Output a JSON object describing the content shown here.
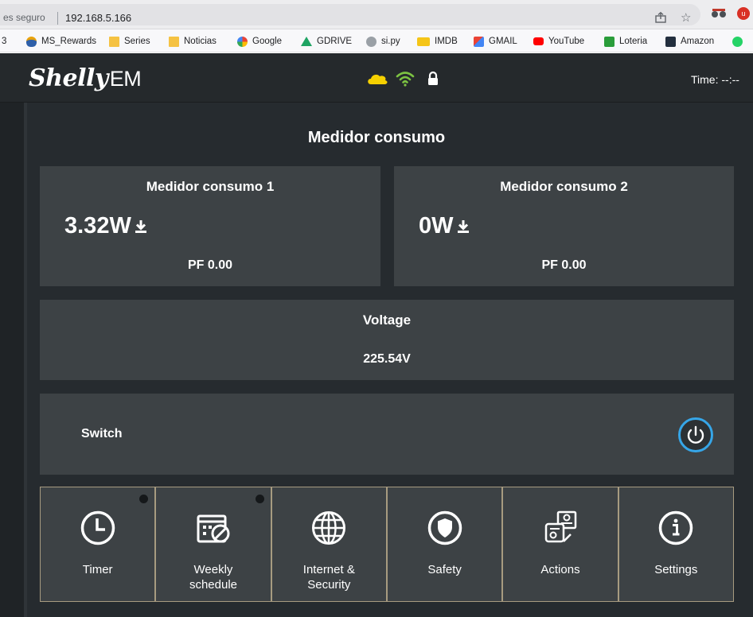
{
  "browser": {
    "security_text": "es seguro",
    "url": "192.168.5.166",
    "bookmarks": [
      {
        "label": "3",
        "icon": "none"
      },
      {
        "label": "MS_Rewards",
        "icon": "medal-icon"
      },
      {
        "label": "Series",
        "icon": "folder-icon"
      },
      {
        "label": "Noticias",
        "icon": "folder-icon"
      },
      {
        "label": "Google",
        "icon": "google-icon"
      },
      {
        "label": "GDRIVE",
        "icon": "gdrive-icon"
      },
      {
        "label": "si.py",
        "icon": "globe-icon"
      },
      {
        "label": "IMDB",
        "icon": "imdb-icon"
      },
      {
        "label": "GMAIL",
        "icon": "gmail-icon"
      },
      {
        "label": "YouTube",
        "icon": "youtube-icon"
      },
      {
        "label": "Loteria",
        "icon": "loteria-icon"
      },
      {
        "label": "Amazon",
        "icon": "amazon-icon"
      },
      {
        "label": "",
        "icon": "whatsapp-icon"
      }
    ]
  },
  "header": {
    "logo": "Shelly",
    "logo_suffix": "EM",
    "time_label": "Time: --:--",
    "status_icons": [
      "cloud-icon",
      "wifi-icon",
      "lock-icon"
    ]
  },
  "main": {
    "title": "Medidor consumo",
    "meters": [
      {
        "title": "Medidor consumo 1",
        "power": "3.32W",
        "pf": "PF 0.00"
      },
      {
        "title": "Medidor consumo 2",
        "power": "0W",
        "pf": "PF 0.00"
      }
    ],
    "voltage": {
      "title": "Voltage",
      "value": "225.54V"
    },
    "switch": {
      "label": "Switch"
    },
    "menu": [
      {
        "label": "Timer",
        "icon": "clock-icon",
        "dot": true
      },
      {
        "label": "Weekly\nschedule",
        "icon": "calendar-icon",
        "dot": true
      },
      {
        "label": "Internet &\nSecurity",
        "icon": "globe-icon",
        "dot": false
      },
      {
        "label": "Safety",
        "icon": "shield-icon",
        "dot": false
      },
      {
        "label": "Actions",
        "icon": "actions-icon",
        "dot": false
      },
      {
        "label": "Settings",
        "icon": "info-icon",
        "dot": false
      }
    ]
  },
  "colors": {
    "app_bg": "#262b2f",
    "card_bg": "#3d4245",
    "accent_blue": "#36a6e8",
    "cloud_yellow": "#f5d000",
    "wifi_green": "#7cc242",
    "menu_border": "#a79b80"
  }
}
